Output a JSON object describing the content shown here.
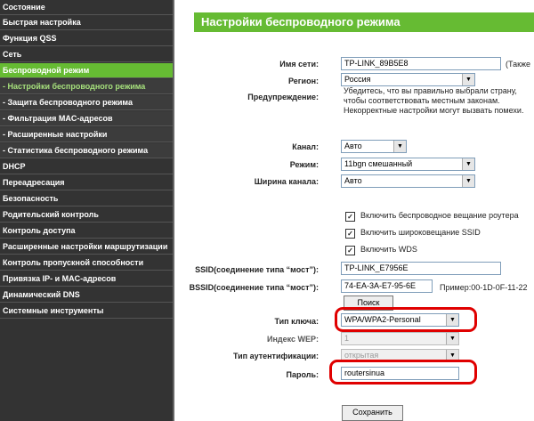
{
  "nav": {
    "status": "Состояние",
    "quick_setup": "Быстрая настройка",
    "qss": "Функция QSS",
    "network": "Сеть",
    "wireless": "Беспроводной режим",
    "wireless_settings": "- Настройки беспроводного режима",
    "wireless_security": "- Защита беспроводного режима",
    "mac_filter": "- Фильтрация MAC-адресов",
    "advanced": "- Расширенные настройки",
    "statistics": "- Статистика беспроводного режима",
    "dhcp": "DHCP",
    "forwarding": "Переадресация",
    "security": "Безопасность",
    "parental": "Родительский контроль",
    "access_control": "Контроль доступа",
    "routing": "Расширенные настройки маршрутизации",
    "bandwidth": "Контроль пропускной способности",
    "ip_mac": "Привязка IP- и MAC-адресов",
    "ddns": "Динамический DNS",
    "system_tools": "Системные инструменты"
  },
  "main": {
    "title": "Настройки беспроводного режима",
    "ssid_label": "Имя сети:",
    "ssid_value": "TP-LINK_89B5E8",
    "ssid_suffix": "(Также",
    "region_label": "Регион:",
    "region_value": "Россия",
    "warning_label": "Предупреждение:",
    "warning_text": "Убедитесь, что вы правильно выбрали страну, чтобы соответствовать местным законам. Некорректные настройки могут вызвать помехи.",
    "channel_label": "Канал:",
    "channel_value": "Авто",
    "mode_label": "Режим:",
    "mode_value": "11bgn смешанный",
    "width_label": "Ширина канала:",
    "width_value": "Авто",
    "cb_broadcast": "Включить беспроводное вещание роутера",
    "cb_ssid": "Включить широковещание SSID",
    "cb_wds": "Включить WDS",
    "wds_ssid_label": "SSID(соединение типа “мост”):",
    "wds_ssid_value": "TP-LINK_E7956E",
    "wds_bssid_label": "BSSID(соединение типа “мост”):",
    "wds_bssid_value": "74-EA-3A-E7-95-6E",
    "example": "Пример:00-1D-0F-11-22",
    "search_button": "Поиск",
    "key_type_label": "Тип ключа:",
    "key_type_value": "WPA/WPA2-Personal",
    "wep_index_label": "Индекс WEP:",
    "wep_index_value": "1",
    "auth_type_label": "Тип аутентификации:",
    "auth_type_value": "открытая",
    "password_label": "Пароль:",
    "password_value": "routersinua",
    "save_button": "Сохранить"
  },
  "colors": {
    "accent": "#66bb33",
    "sidebar": "#333333",
    "highlight": "#e00000"
  }
}
